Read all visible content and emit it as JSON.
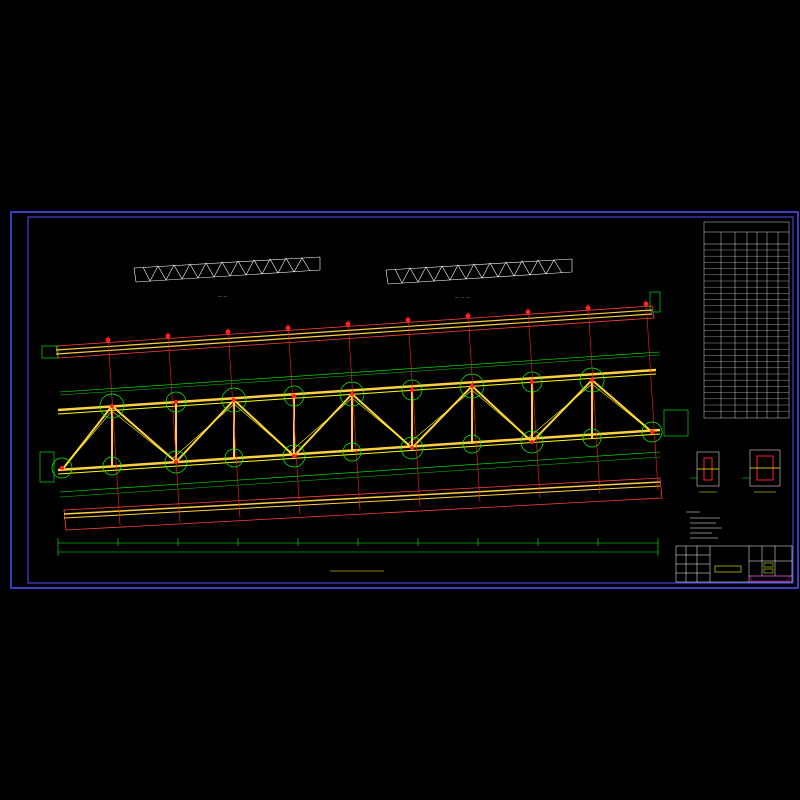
{
  "drawing": {
    "background": "#000000",
    "frame_color": "#5050ff",
    "colors": {
      "chord": "#ffd040",
      "member": "#ffff00",
      "node": "#ff2020",
      "dim": "#00ff00",
      "outline": "#ff4040",
      "text": "#ffffff",
      "magenta": "#ff00ff",
      "cyan": "#00ffff"
    },
    "symbols": [
      "truss-elevation",
      "truss-minor-elevation-1",
      "truss-minor-elevation-2",
      "material-table",
      "joint-details",
      "title-block"
    ]
  }
}
